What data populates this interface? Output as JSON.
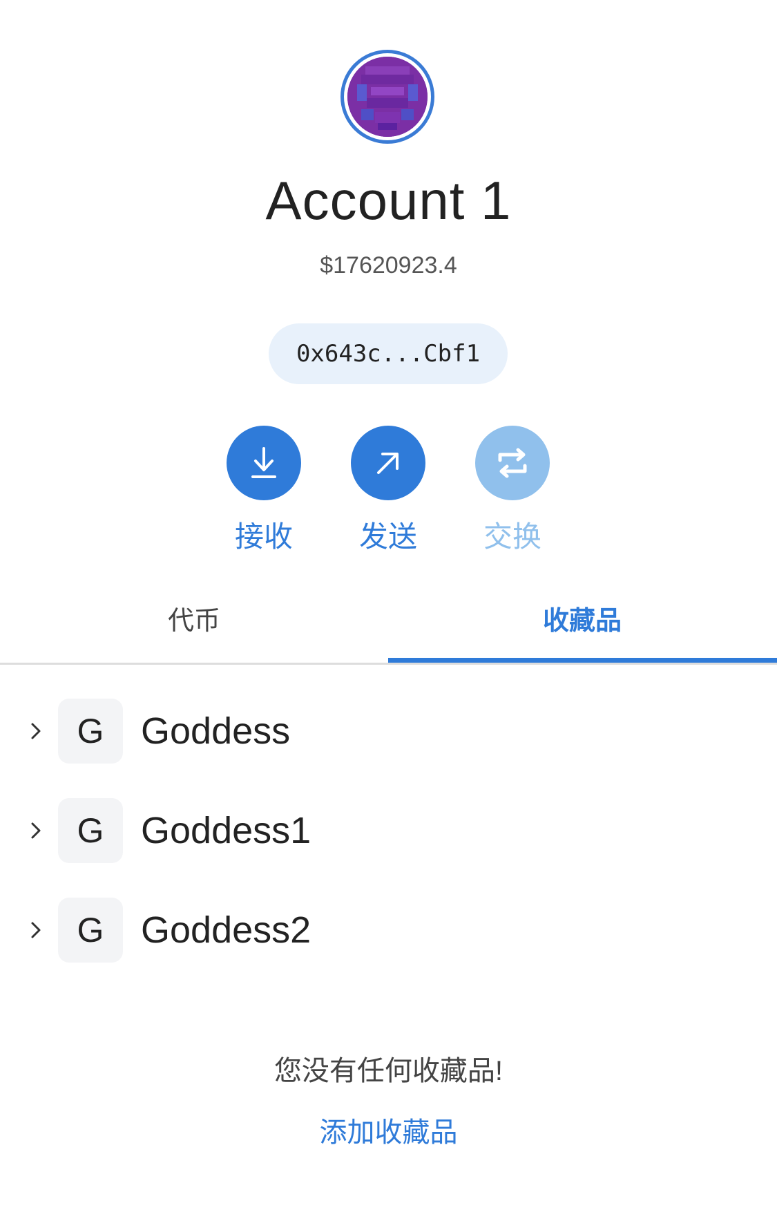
{
  "account": {
    "name": "Account 1",
    "balance": "$17620923.4",
    "address_short": "0x643c...Cbf1"
  },
  "actions": [
    {
      "label": "接收",
      "icon": "download-icon",
      "enabled": true
    },
    {
      "label": "发送",
      "icon": "arrow-up-right-icon",
      "enabled": true
    },
    {
      "label": "交换",
      "icon": "swap-icon",
      "enabled": false
    }
  ],
  "tabs": [
    {
      "label": "代币",
      "active": false
    },
    {
      "label": "收藏品",
      "active": true
    }
  ],
  "collections": [
    {
      "initial": "G",
      "name": "Goddess"
    },
    {
      "initial": "G",
      "name": "Goddess1"
    },
    {
      "initial": "G",
      "name": "Goddess2"
    }
  ],
  "empty_state": {
    "message": "您没有任何收藏品!",
    "add_link": "添加收藏品"
  },
  "colors": {
    "accent": "#2f7bd9",
    "accent_disabled": "#90c0ec",
    "address_bg": "#e8f1fb",
    "avatar_ring": "#3a7bd5",
    "avatar_fill": "#7b2fa5"
  }
}
